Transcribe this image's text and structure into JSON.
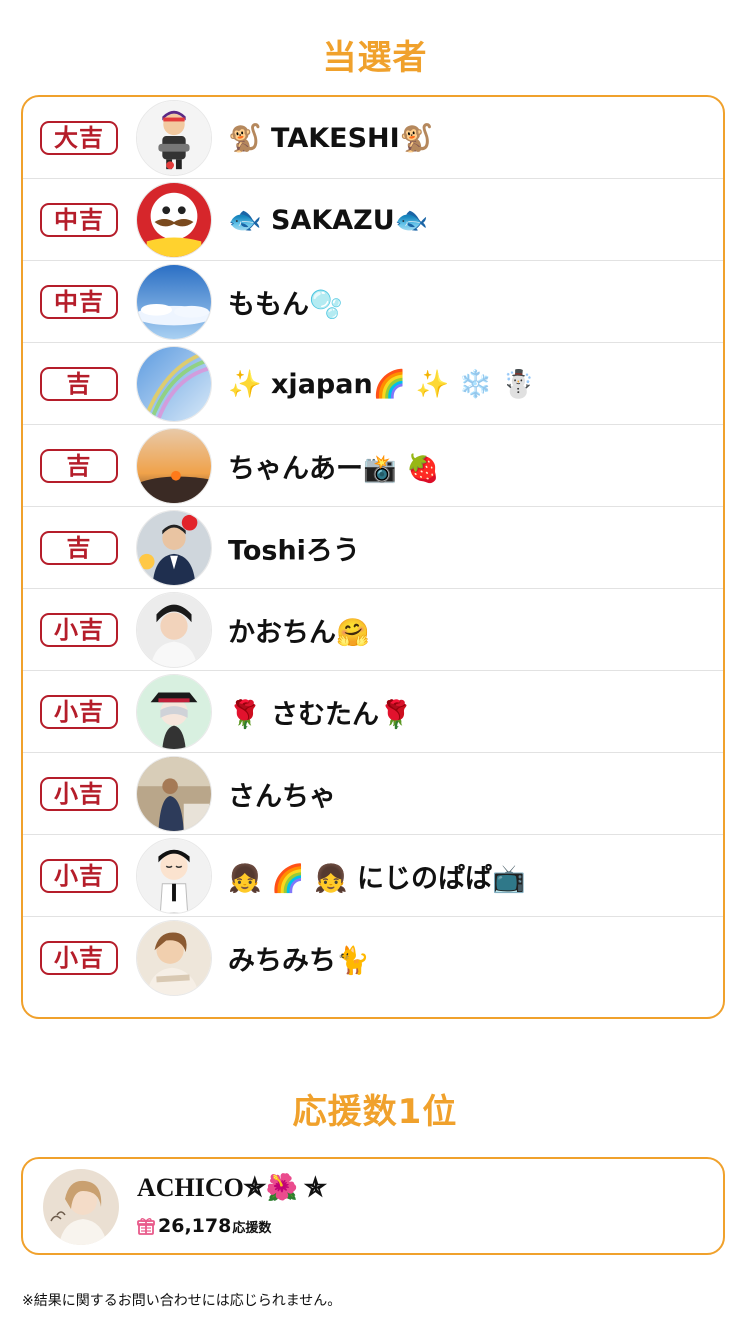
{
  "winners_title": "当選者",
  "winners": [
    {
      "rank": "大吉",
      "name": "🐒 TAKESHI🐒"
    },
    {
      "rank": "中吉",
      "name": "🐟 SAKAZU🐟"
    },
    {
      "rank": "中吉",
      "name": "ももん🫧"
    },
    {
      "rank": "吉",
      "name": "✨ xjapan🌈 ✨ ❄️ ☃️"
    },
    {
      "rank": "吉",
      "name": "ちゃんあー📸 🍓"
    },
    {
      "rank": "吉",
      "name": "Toshiろう"
    },
    {
      "rank": "小吉",
      "name": "かおちん🤗"
    },
    {
      "rank": "小吉",
      "name": "🌹 さむたん🌹"
    },
    {
      "rank": "小吉",
      "name": "さんちゃ"
    },
    {
      "rank": "小吉",
      "name": "👧 🌈 👧 にじのぱぱ📺"
    },
    {
      "rank": "小吉",
      "name": "みちみち🐈"
    }
  ],
  "support_title": "応援数1位",
  "top_supporter": {
    "name": "ACHICO✯🌺 ✯",
    "count": "26,178",
    "unit": "応援数"
  },
  "disclaimer": "※結果に関するお問い合わせには応じられません。",
  "colors": {
    "accent": "#f0a12c",
    "rank_red": "#b51d2a",
    "gift_pink": "#e85a8a"
  }
}
